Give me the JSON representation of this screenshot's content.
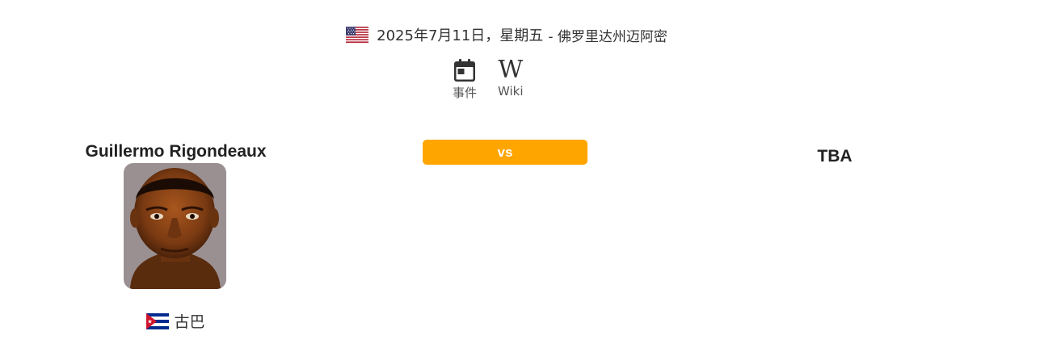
{
  "event": {
    "date": "2025年7月11日，星期五",
    "location": "- 佛罗里达州迈阿密",
    "country_flag": "us-flag"
  },
  "links": [
    {
      "label": "事件",
      "icon": "calendar-icon"
    },
    {
      "label": "Wiki",
      "icon": "wikipedia-icon",
      "glyph": "W"
    }
  ],
  "fight": {
    "vs_label": "vs",
    "accent_color": "#ffa500",
    "fighter_left": {
      "name": "Guillermo Rigondeaux",
      "country": "古巴",
      "country_flag": "cuba-flag"
    },
    "fighter_right": {
      "name": "TBA"
    }
  }
}
